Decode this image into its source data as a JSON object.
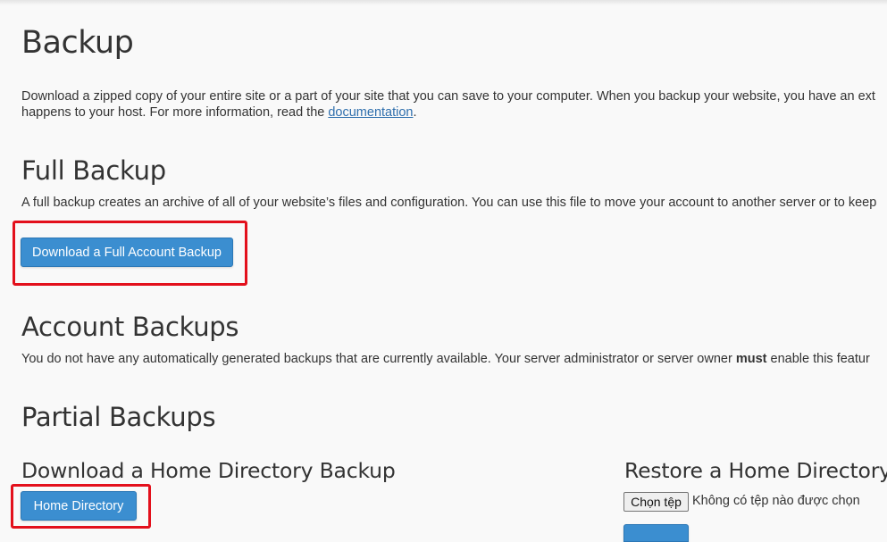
{
  "page": {
    "title": "Backup",
    "intro_line1": "Download a zipped copy of your entire site or a part of your site that you can save to your computer. When you backup your website, you have an ext",
    "intro_line2_prefix": "happens to your host. For more information, read the ",
    "intro_link": "documentation",
    "intro_line2_suffix": "."
  },
  "full_backup": {
    "heading": "Full Backup",
    "description": "A full backup creates an archive of all of your website’s files and configuration. You can use this file to move your account to another server or to keep",
    "button_label": "Download a Full Account Backup"
  },
  "account_backups": {
    "heading": "Account Backups",
    "description_prefix": "You do not have any automatically generated backups that are currently available. Your server administrator or server owner ",
    "description_bold": "must",
    "description_suffix": " enable this featur"
  },
  "partial_backups": {
    "heading": "Partial Backups",
    "download_home": {
      "heading": "Download a Home Directory Backup",
      "button_label": "Home Directory"
    },
    "restore_home": {
      "heading": "Restore a Home Directory",
      "file_button_label": "Chọn tệp",
      "file_status": "Không có tệp nào được chọn"
    }
  },
  "colors": {
    "primary_button": "#3b8ed0",
    "highlight_border": "#e3101c",
    "link": "#2f6fad"
  }
}
